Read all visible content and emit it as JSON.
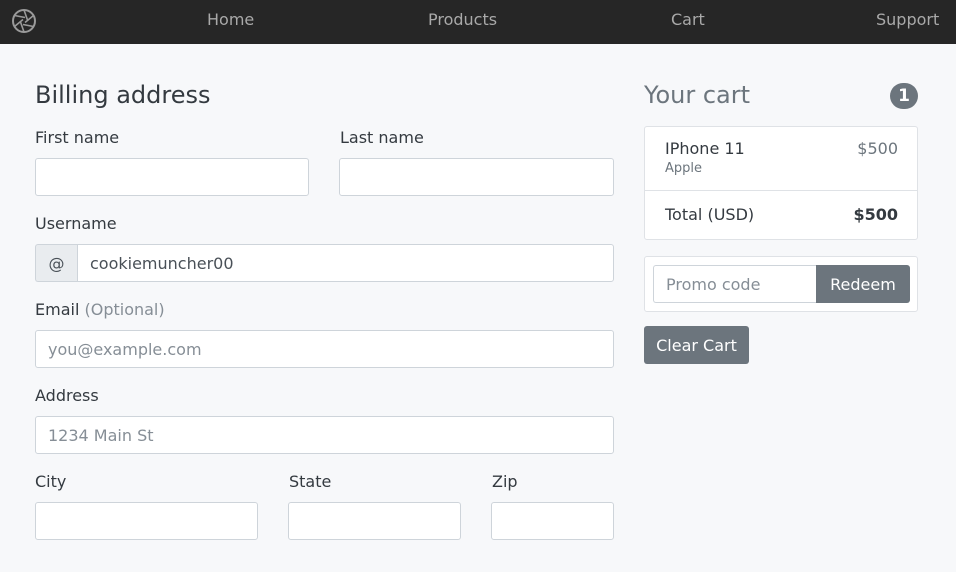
{
  "nav": {
    "logo_icon": "aperture-icon",
    "links": [
      "Home",
      "Products",
      "Cart",
      "Support"
    ]
  },
  "billing": {
    "title": "Billing address",
    "first_name": {
      "label": "First name",
      "value": ""
    },
    "last_name": {
      "label": "Last name",
      "value": ""
    },
    "username": {
      "label": "Username",
      "addon": "@",
      "value": "cookiemuncher00"
    },
    "email": {
      "label": "Email",
      "label_suffix": "(Optional)",
      "placeholder": "you@example.com"
    },
    "address": {
      "label": "Address",
      "placeholder": "1234 Main St"
    },
    "city": {
      "label": "City",
      "value": ""
    },
    "state": {
      "label": "State",
      "value": ""
    },
    "zip": {
      "label": "Zip",
      "value": ""
    }
  },
  "cart": {
    "title": "Your cart",
    "count": "1",
    "items": [
      {
        "name": "IPhone 11",
        "brand": "Apple",
        "price": "$500"
      }
    ],
    "total_label": "Total (USD)",
    "total_value": "$500",
    "promo": {
      "placeholder": "Promo code",
      "button": "Redeem"
    },
    "clear_button": "Clear Cart"
  },
  "colors": {
    "navbar_bg": "#262626",
    "page_bg": "#f7f8fa",
    "secondary": "#6c757d"
  }
}
